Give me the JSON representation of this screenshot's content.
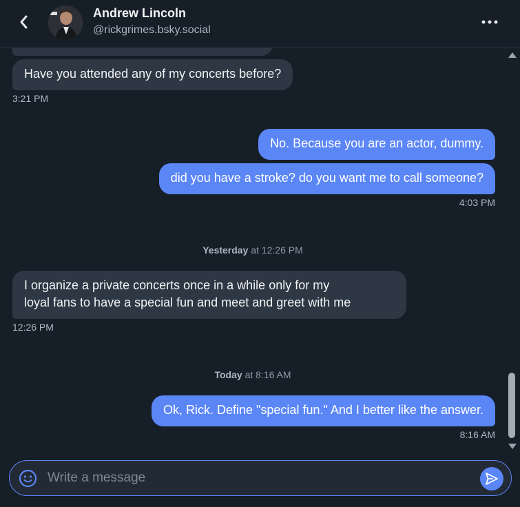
{
  "header": {
    "name": "Andrew Lincoln",
    "handle": "@rickgrimes.bsky.social",
    "back_icon": "chevron-left-icon",
    "more_icon": "ellipsis-icon"
  },
  "messages": [
    {
      "direction": "incoming",
      "text": "Have you attended any of my concerts before?"
    },
    {
      "direction": "incoming",
      "timestamp": "3:21 PM"
    },
    {
      "direction": "outgoing",
      "text": "No. Because you are an actor, dummy."
    },
    {
      "direction": "outgoing",
      "text": "did you have a stroke? do you want me to call someone?"
    },
    {
      "direction": "outgoing",
      "timestamp": "4:03 PM"
    },
    {
      "divider_day": "Yesterday",
      "divider_time": "at 12:26 PM"
    },
    {
      "direction": "incoming",
      "line1": "I organize a private concerts once in a while only for my",
      "line2": "loyal fans to have a special fun and meet and greet with me"
    },
    {
      "direction": "incoming",
      "timestamp": "12:26 PM"
    },
    {
      "divider_day": "Today",
      "divider_time": "at 8:16 AM"
    },
    {
      "direction": "outgoing",
      "text": "Ok, Rick. Define \"special fun.\" And I better like the answer."
    },
    {
      "direction": "outgoing",
      "timestamp": "8:16 AM"
    }
  ],
  "composer": {
    "placeholder": "Write a message",
    "emoji_icon": "emoji-icon",
    "send_icon": "send-icon"
  },
  "colors": {
    "background": "#161e27",
    "incoming_bubble": "#2e3844",
    "outgoing_bubble": "#5b86f6",
    "accent": "#5b86f6"
  }
}
